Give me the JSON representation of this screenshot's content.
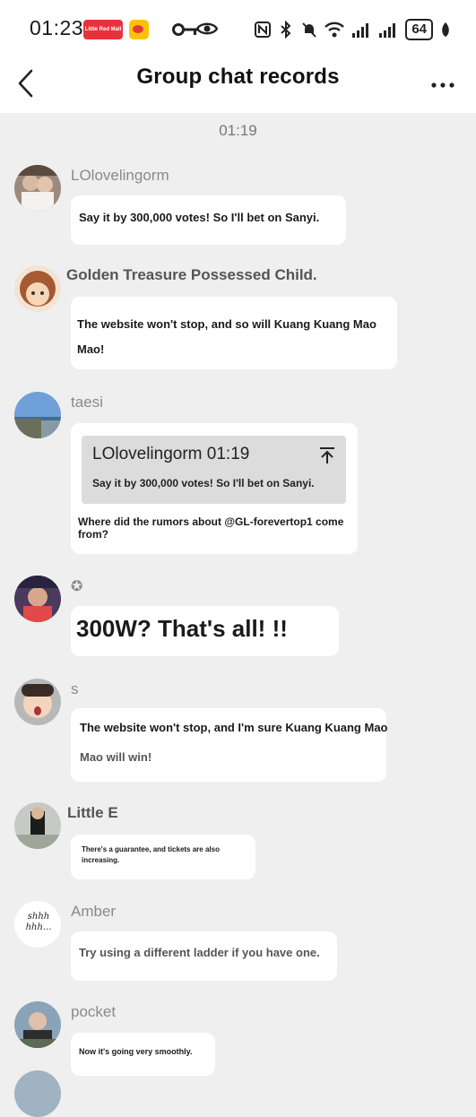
{
  "status_bar": {
    "time": "01:23",
    "app_badge_text": "Little Red Mall",
    "battery": "64"
  },
  "header": {
    "title": "Group chat records"
  },
  "timestamp": "01:19",
  "messages": [
    {
      "name": "LOlovelingorm",
      "text": "Say it by 300,000 votes! So I'll bet on Sanyi."
    },
    {
      "name": "Golden Treasure Possessed Child.",
      "text": "The website won't stop, and so will Kuang Kuang Mao Mao!"
    },
    {
      "name": "taesi",
      "quote": {
        "header": "LOlovelingorm 01:19",
        "text": "Say it by 300,000 votes! So I'll bet on Sanyi."
      },
      "text": "Where did the rumors about @GL-forevertop1 come from?"
    },
    {
      "name": "✪",
      "text": "300W? That's all! !!"
    },
    {
      "name": "s",
      "text_line1": "The website won't stop, and I'm sure Kuang Kuang Mao",
      "text_line2": "Mao will win!"
    },
    {
      "name": "Little E",
      "text": "There's a guarantee, and tickets are also increasing."
    },
    {
      "name": "Amber",
      "avatar_text": "shhh hhh...",
      "text": "Try using a different ladder if you have one."
    },
    {
      "name": "pocket",
      "text": "Now it's going very smoothly."
    }
  ]
}
